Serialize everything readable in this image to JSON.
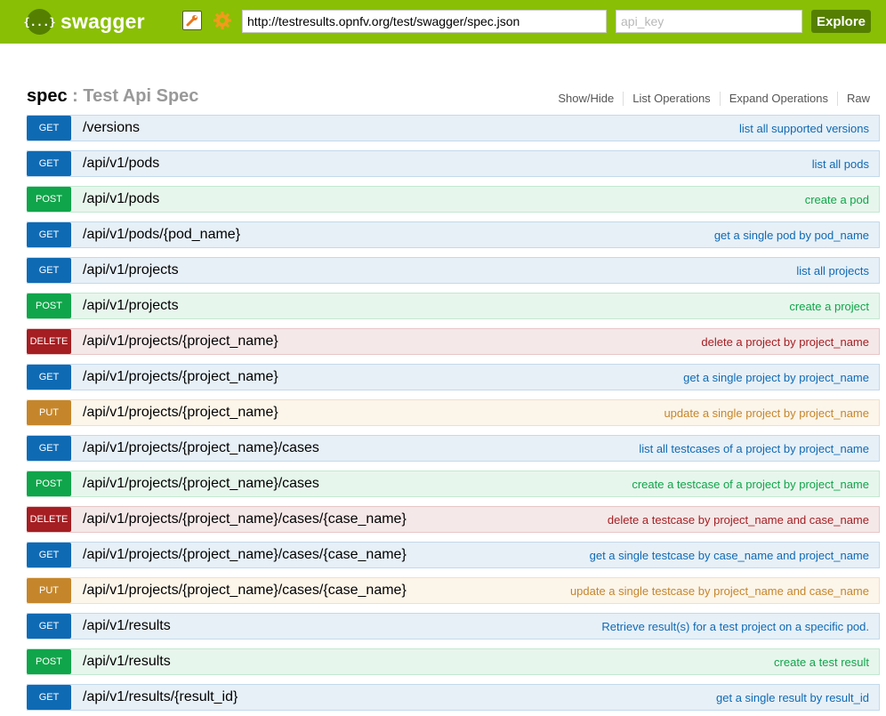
{
  "header": {
    "logo_icon": "{...}",
    "logo_text": "swagger",
    "url_value": "http://testresults.opnfv.org/test/swagger/spec.json",
    "api_key_placeholder": "api_key",
    "explore_label": "Explore",
    "icons": [
      "wrench-icon",
      "gear-icon"
    ]
  },
  "spec": {
    "name": "spec",
    "separator": ":",
    "title": "Test Api Spec",
    "links": [
      "Show/Hide",
      "List Operations",
      "Expand Operations",
      "Raw"
    ]
  },
  "colors": {
    "header_bg": "#89bf04",
    "get": "#0f6ab4",
    "post": "#10a54a",
    "delete": "#a41e22",
    "put": "#c5862b"
  },
  "operations": [
    {
      "method": "GET",
      "path": "/versions",
      "summary": "list all supported versions"
    },
    {
      "method": "GET",
      "path": "/api/v1/pods",
      "summary": "list all pods"
    },
    {
      "method": "POST",
      "path": "/api/v1/pods",
      "summary": "create a pod"
    },
    {
      "method": "GET",
      "path": "/api/v1/pods/{pod_name}",
      "summary": "get a single pod by pod_name"
    },
    {
      "method": "GET",
      "path": "/api/v1/projects",
      "summary": "list all projects"
    },
    {
      "method": "POST",
      "path": "/api/v1/projects",
      "summary": "create a project"
    },
    {
      "method": "DELETE",
      "path": "/api/v1/projects/{project_name}",
      "summary": "delete a project by project_name"
    },
    {
      "method": "GET",
      "path": "/api/v1/projects/{project_name}",
      "summary": "get a single project by project_name"
    },
    {
      "method": "PUT",
      "path": "/api/v1/projects/{project_name}",
      "summary": "update a single project by project_name"
    },
    {
      "method": "GET",
      "path": "/api/v1/projects/{project_name}/cases",
      "summary": "list all testcases of a project by project_name"
    },
    {
      "method": "POST",
      "path": "/api/v1/projects/{project_name}/cases",
      "summary": "create a testcase of a project by project_name"
    },
    {
      "method": "DELETE",
      "path": "/api/v1/projects/{project_name}/cases/{case_name}",
      "summary": "delete a testcase by project_name and case_name"
    },
    {
      "method": "GET",
      "path": "/api/v1/projects/{project_name}/cases/{case_name}",
      "summary": "get a single testcase by case_name and project_name"
    },
    {
      "method": "PUT",
      "path": "/api/v1/projects/{project_name}/cases/{case_name}",
      "summary": "update a single testcase by project_name and case_name"
    },
    {
      "method": "GET",
      "path": "/api/v1/results",
      "summary": "Retrieve result(s) for a test project on a specific pod."
    },
    {
      "method": "POST",
      "path": "/api/v1/results",
      "summary": "create a test result"
    },
    {
      "method": "GET",
      "path": "/api/v1/results/{result_id}",
      "summary": "get a single result by result_id"
    }
  ]
}
